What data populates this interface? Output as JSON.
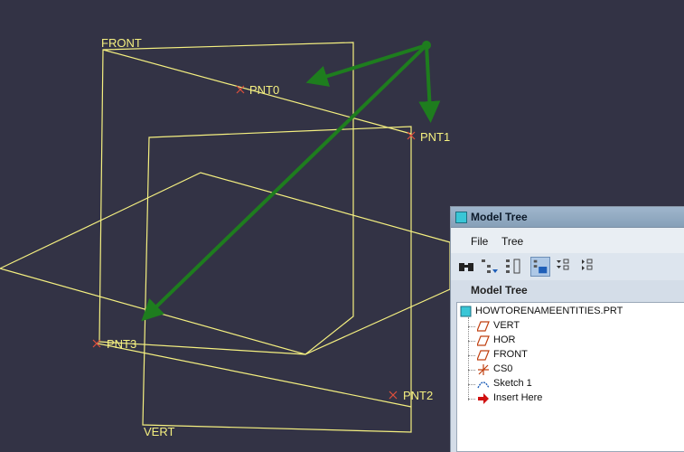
{
  "viewport": {
    "plane_labels": [
      "FRONT",
      "VERT"
    ],
    "point_labels": [
      "PNT0",
      "PNT1",
      "PNT2",
      "PNT3"
    ],
    "colors": {
      "background": "#333345",
      "geometry": "#f5f080",
      "arrow": "#1e7d1e",
      "point_marker": "#e0503c"
    }
  },
  "model_tree": {
    "title": "Model Tree",
    "menu": [
      "File",
      "Tree"
    ],
    "toolbar_icons": [
      "binoculars-icon",
      "tree-filter-icon",
      "tree-columns-icon",
      "show-features-icon",
      "expand-collapse-icon",
      "tree-settings-icon"
    ],
    "panel_heading": "Model Tree",
    "root": "HOWTORENAMEENTITIES.PRT",
    "items": [
      {
        "label": "VERT",
        "icon": "datum-plane-icon"
      },
      {
        "label": "HOR",
        "icon": "datum-plane-icon"
      },
      {
        "label": "FRONT",
        "icon": "datum-plane-icon"
      },
      {
        "label": "CS0",
        "icon": "coordinate-system-icon"
      },
      {
        "label": "Sketch 1",
        "icon": "sketch-icon"
      },
      {
        "label": "Insert Here",
        "icon": "insert-arrow-icon"
      }
    ]
  }
}
